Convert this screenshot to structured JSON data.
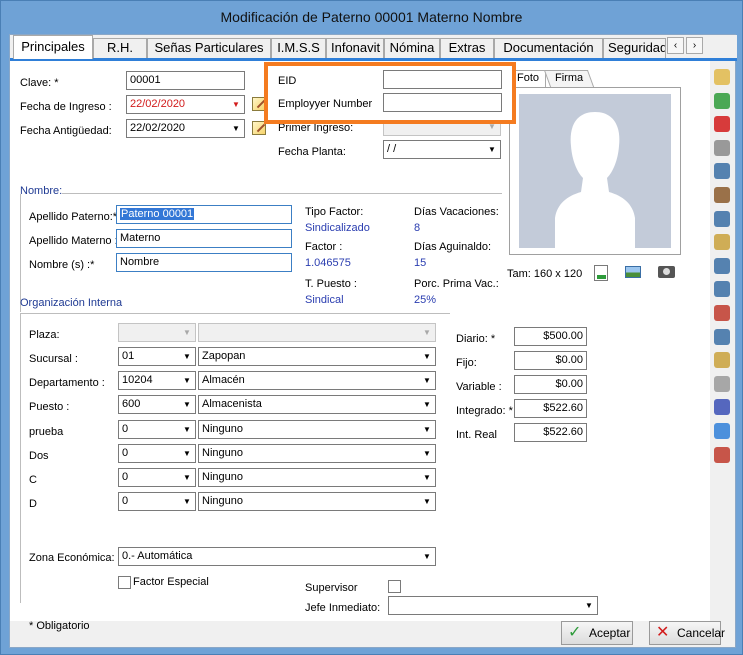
{
  "window": {
    "title": "Modificación de Paterno 00001 Materno  Nombre"
  },
  "tabs": [
    "Principales",
    "R.H.",
    "Señas Particulares",
    "I.M.S.S",
    "Infonavit",
    "Nómina",
    "Extras",
    "Documentación",
    "Seguridad"
  ],
  "tab_scroll": {
    "left": "‹",
    "right": "›"
  },
  "general": {
    "clave_label": "Clave: *",
    "clave_value": "00001",
    "fecha_ingreso_label": "Fecha de Ingreso :",
    "fecha_ingreso_value": "22/02/2020",
    "fecha_antiguedad_label": "Fecha Antigüedad:",
    "fecha_antiguedad_value": "22/02/2020",
    "primer_ingreso_label": "Primer Ingreso:",
    "fecha_planta_label": "Fecha Planta:",
    "fecha_planta_value": " /  /"
  },
  "custom_fields": {
    "eid_label": "EID",
    "eid_value": "",
    "employer_label": "Employyer Number",
    "employer_value": ""
  },
  "nombre": {
    "section_label": "Nombre:",
    "apellido_paterno_label": "Apellido Paterno:*",
    "apellido_paterno_value": "Paterno 00001",
    "apellido_materno_label": "Apellido Materno :",
    "apellido_materno_value": "Materno",
    "nombres_label": "Nombre (s) :*",
    "nombres_value": "Nombre"
  },
  "factors": {
    "tipo_factor_label": "Tipo Factor:",
    "tipo_factor_value": "Sindicalizado",
    "factor_label": "Factor :",
    "factor_value": "1.046575",
    "t_puesto_label": "T. Puesto :",
    "t_puesto_value": "Sindical",
    "dias_vacaciones_label": "Días Vacaciones:",
    "dias_vacaciones_value": "8",
    "dias_aguinaldo_label": "Días Aguinaldo:",
    "dias_aguinaldo_value": "15",
    "prima_vac_label": "Porc. Prima Vac.:",
    "prima_vac_value": "25%"
  },
  "photo": {
    "tab_foto": "Foto",
    "tab_firma": "Firma",
    "size_label": "Tam: 160 x 120"
  },
  "organizacion": {
    "section_label": "Organización Interna",
    "rows": [
      {
        "label": "Plaza:",
        "code": "",
        "name": ""
      },
      {
        "label": "Sucursal :",
        "code": "01",
        "name": "Zapopan"
      },
      {
        "label": "Departamento :",
        "code": "10204",
        "name": "Almacén"
      },
      {
        "label": "Puesto :",
        "code": "600",
        "name": "Almacenista"
      },
      {
        "label": "prueba",
        "code": "0",
        "name": "Ninguno"
      },
      {
        "label": "Dos",
        "code": "0",
        "name": "Ninguno"
      },
      {
        "label": "C",
        "code": "0",
        "name": "Ninguno"
      },
      {
        "label": "D",
        "code": "0",
        "name": "Ninguno"
      }
    ],
    "zona_label": "Zona Económica:",
    "zona_value": "0.- Automática",
    "factor_especial_label": "Factor Especial",
    "supervisor_label": "Supervisor",
    "jefe_label": "Jefe Inmediato:",
    "jefe_value": ""
  },
  "salarios": [
    {
      "label": "Diario: *",
      "value": "$500.00"
    },
    {
      "label": "Fijo:",
      "value": "$0.00"
    },
    {
      "label": "Variable :",
      "value": "$0.00"
    },
    {
      "label": "Integrado: *",
      "value": "$522.60"
    },
    {
      "label": "Int. Real",
      "value": "$522.60"
    }
  ],
  "footer": {
    "obligatorio": "* Obligatorio",
    "aceptar_label": "Aceptar",
    "cancelar_label": "Cancelar"
  },
  "sidebar_icons": [
    "folder-icon",
    "recycle-icon",
    "fire-extinguisher-icon",
    "alarm-clock-icon",
    "user-alert-icon",
    "box-icon",
    "users-icon",
    "user-card-icon",
    "user-list-icon",
    "users-group-icon",
    "gifts-icon",
    "document-user-icon",
    "clipboard-icon",
    "copy-icon",
    "warning-icon",
    "table-icon",
    "truck-icon"
  ],
  "colors": {
    "accent": "#2f7fd8",
    "highlight": "#f47b20",
    "value_blue": "#2a3db0",
    "date_red": "#d21b1b"
  }
}
